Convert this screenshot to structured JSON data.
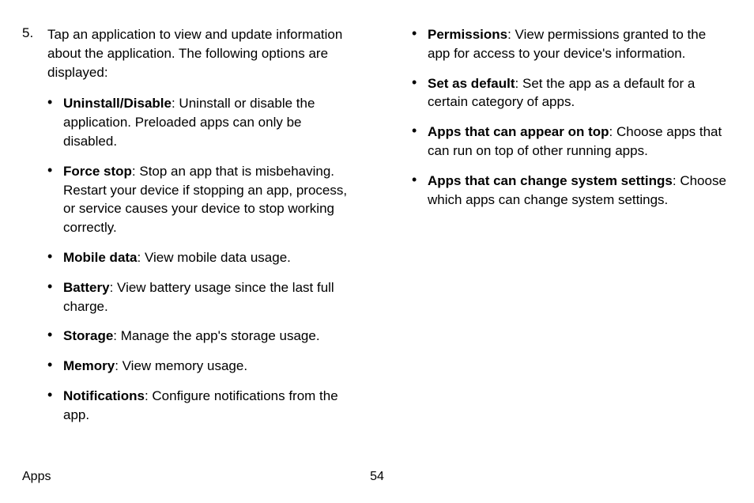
{
  "step": {
    "number": "5.",
    "text": "Tap an application to view and update information about the application. The following options are displayed:"
  },
  "col1": [
    {
      "label": "Uninstall/Disable",
      "desc": ": Uninstall or disable the application. Preloaded apps can only be disabled."
    },
    {
      "label": "Force stop",
      "desc": ": Stop an app that is misbehaving. Restart your device if stopping an app, process, or service causes your device to stop working correctly."
    },
    {
      "label": "Mobile data",
      "desc": ": View mobile data usage."
    },
    {
      "label": "Battery",
      "desc": ": View battery usage since the last full charge."
    },
    {
      "label": "Storage",
      "desc": ": Manage the app's storage usage."
    },
    {
      "label": "Memory",
      "desc": ": View memory usage."
    },
    {
      "label": "Notifications",
      "desc": ": Configure notifications from the app."
    }
  ],
  "col2": [
    {
      "label": "Permissions",
      "desc": ": View permissions granted to the app for access to your device's information."
    },
    {
      "label": "Set as default",
      "desc": ": Set the app as a default for a certain category of apps."
    },
    {
      "label": "Apps that can appear on top",
      "desc": ": Choose apps that can run on top of other running apps."
    },
    {
      "label": "Apps that can change system settings",
      "desc": ": Choose which apps can change system settings."
    }
  ],
  "footer": {
    "section": "Apps",
    "page": "54"
  },
  "bullet": "•"
}
